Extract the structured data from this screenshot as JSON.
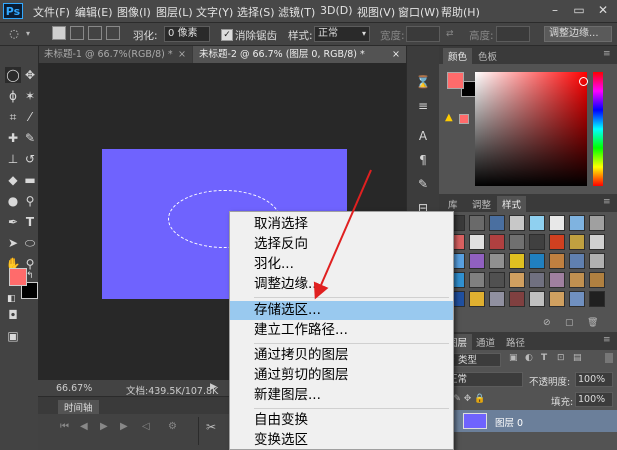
{
  "app": {
    "logo": "Ps"
  },
  "menubar": {
    "items": [
      "文件(F)",
      "编辑(E)",
      "图像(I)",
      "图层(L)",
      "文字(Y)",
      "选择(S)",
      "滤镜(T)",
      "3D(D)",
      "视图(V)",
      "窗口(W)",
      "帮助(H)"
    ]
  },
  "options": {
    "feather_label": "羽化:",
    "feather_value": "0 像素",
    "antialias_label": "消除锯齿",
    "style_label": "样式:",
    "style_value": "正常",
    "width_label": "宽度:",
    "height_label": "高度:",
    "refine_button": "调整边缘..."
  },
  "tabs": [
    {
      "label": "未标题-1 @ 66.7%(RGB/8) *",
      "active": false
    },
    {
      "label": "未标题-2 @ 66.7% (图层 0, RGB/8) *",
      "active": true
    }
  ],
  "status": {
    "zoom": "66.67%",
    "doc": "文档:439.5K/107.8K"
  },
  "timeline": {
    "title": "时间轴"
  },
  "color_panel": {
    "tabs": [
      "颜色",
      "色板"
    ]
  },
  "swatch_panel": {
    "tabs": [
      "库",
      "调整",
      "样式"
    ]
  },
  "layers_panel": {
    "tabs": [
      "图层",
      "通道",
      "路径"
    ],
    "kind_label": "类型",
    "blend_mode": "正常",
    "opacity_label": "不透明度:",
    "opacity_value": "100%",
    "fill_label": "填充:",
    "fill_value": "100%",
    "layer_name": "图层 0"
  },
  "colors": {
    "foreground": "#ff6b6b",
    "background": "#000000",
    "document": "#6f63fe"
  },
  "context_menu": {
    "items": [
      {
        "label": "取消选择",
        "highlighted": false
      },
      {
        "label": "选择反向",
        "highlighted": false
      },
      {
        "label": "羽化...",
        "highlighted": false
      },
      {
        "label": "调整边缘...",
        "highlighted": false
      },
      {
        "label": "存储选区...",
        "highlighted": true
      },
      {
        "label": "建立工作路径...",
        "highlighted": false
      },
      {
        "label": "通过拷贝的图层",
        "highlighted": false
      },
      {
        "label": "通过剪切的图层",
        "highlighted": false
      },
      {
        "label": "新建图层...",
        "highlighted": false
      },
      {
        "label": "自由变换",
        "highlighted": false
      },
      {
        "label": "变换选区",
        "highlighted": false
      }
    ]
  }
}
